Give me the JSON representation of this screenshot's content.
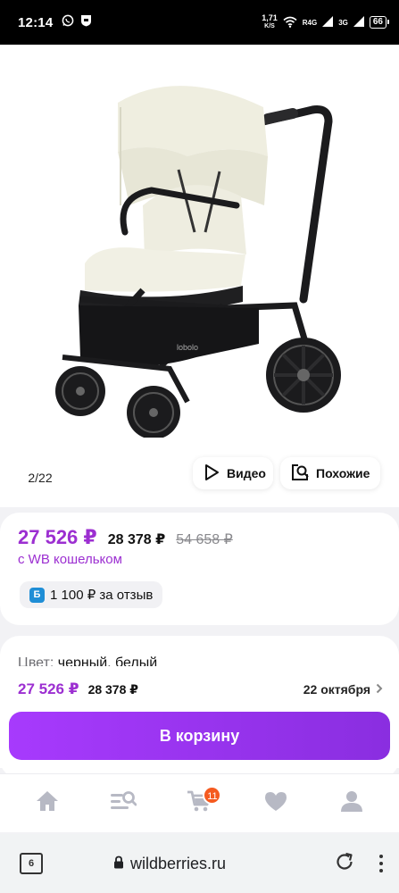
{
  "status_bar": {
    "time": "12:14",
    "net_speed_value": "1,71",
    "net_speed_unit": "K/S",
    "sim1_label": "R4G",
    "sim2_label": "3G",
    "battery": "66"
  },
  "gallery": {
    "counter": "2/22",
    "video_label": "Видео",
    "similar_label": "Похожие",
    "brand_mark": "lobolo"
  },
  "price": {
    "wallet_price": "27 526 ₽",
    "regular_price": "28 378 ₽",
    "old_price": "54 658 ₽",
    "wallet_note": "с WB кошельком",
    "bonus_badge": "Б",
    "bonus_text": "1 100 ₽ за отзыв"
  },
  "details": {
    "color_label": "Цвет:",
    "color_value": "черный, белый"
  },
  "buy_panel": {
    "wallet_price": "27 526 ₽",
    "regular_price": "28 378 ₽",
    "delivery_date": "22 октября",
    "cart_button": "В корзину"
  },
  "bottom_nav": {
    "items": [
      "home-icon",
      "catalog-search-icon",
      "cart-icon",
      "heart-icon",
      "profile-icon"
    ],
    "cart_count": "11"
  },
  "browser": {
    "tab_count": "6",
    "url": "wildberries.ru"
  },
  "colors": {
    "accent": "#9c2fd1",
    "button_gradient_start": "#a73afd",
    "button_gradient_end": "#8a2ee0",
    "badge": "#f55a1f",
    "bonus_badge": "#1f8ed6"
  }
}
